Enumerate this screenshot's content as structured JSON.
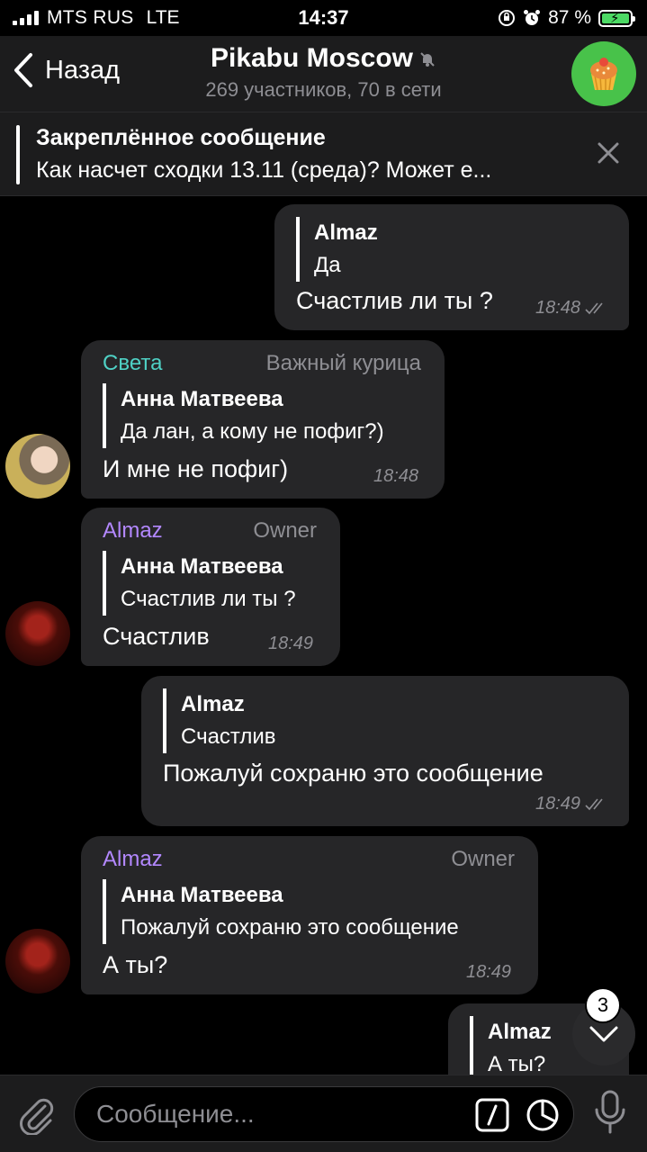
{
  "status_bar": {
    "carrier": "MTS RUS",
    "network": "LTE",
    "time": "14:37",
    "battery": "87 %"
  },
  "header": {
    "back_label": "Назад",
    "title": "Pikabu Moscow",
    "subtitle": "269 участников, 70 в сети"
  },
  "pinned": {
    "title": "Закреплённое сообщение",
    "text": "Как насчет  сходки 13.11 (среда)? Может е..."
  },
  "messages": [
    {
      "direction": "out",
      "reply_name": "Almaz",
      "reply_text": "Да",
      "text": "Счастлив ли ты ?",
      "time": "18:48"
    },
    {
      "direction": "in",
      "sender": "Света",
      "sender_color": "#4fd1c5",
      "role": "Важный курица",
      "reply_name": "Анна Матвеева",
      "reply_text": "Да лан, а кому не пофиг?)",
      "text": "И мне не пофиг)",
      "time": "18:48"
    },
    {
      "direction": "in",
      "sender": "Almaz",
      "sender_color": "#b388ff",
      "role": "Owner",
      "reply_name": "Анна Матвеева",
      "reply_text": "Счастлив ли ты ?",
      "text": "Счастлив",
      "time": "18:49"
    },
    {
      "direction": "out",
      "reply_name": "Almaz",
      "reply_text": "Счастлив",
      "text": "Пожалуй сохраню это сообщение",
      "time": "18:49"
    },
    {
      "direction": "in",
      "sender": "Almaz",
      "sender_color": "#b388ff",
      "role": "Owner",
      "reply_name": "Анна Матвеева",
      "reply_text": "Пожалуй сохраню это сообщение",
      "text": "А ты?",
      "time": "18:49"
    },
    {
      "direction": "out",
      "reply_name": "Almaz",
      "reply_text": "А ты?"
    }
  ],
  "scroll_button": {
    "unread_count": "3"
  },
  "input": {
    "placeholder": "Сообщение..."
  },
  "icons": {
    "back": "chevron-left-icon",
    "mute": "muted-bell-icon",
    "close": "close-icon",
    "attach": "paperclip-icon",
    "commands": "slash-command-icon",
    "sticker": "sticker-icon",
    "mic": "microphone-icon",
    "scroll": "chevron-down-icon"
  }
}
